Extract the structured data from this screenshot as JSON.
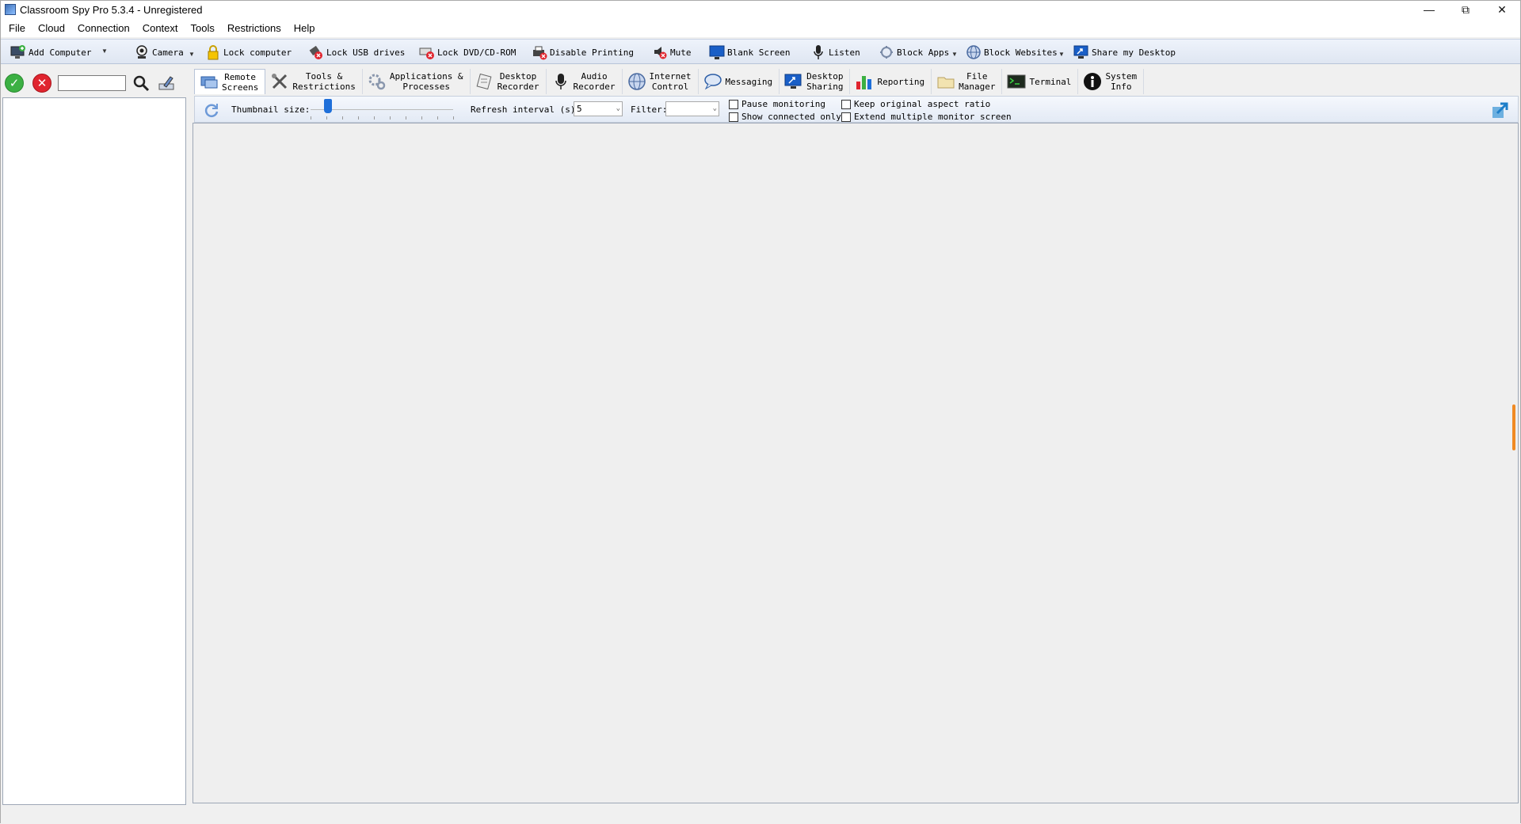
{
  "window": {
    "title": "Classroom Spy Pro 5.3.4 - Unregistered"
  },
  "menu": [
    "File",
    "Cloud",
    "Connection",
    "Context",
    "Tools",
    "Restrictions",
    "Help"
  ],
  "toolbar": {
    "add_computer": "Add Computer",
    "camera": "Camera",
    "lock_computer": "Lock computer",
    "lock_usb": "Lock USB drives",
    "lock_dvd": "Lock DVD/CD-ROM",
    "disable_printing": "Disable Printing",
    "mute": "Mute",
    "blank_screen": "Blank Screen",
    "listen": "Listen",
    "block_apps": "Block Apps",
    "block_websites": "Block Websites",
    "share_desktop": "Share my Desktop"
  },
  "tabs": [
    {
      "line1": "Remote",
      "line2": "Screens"
    },
    {
      "line1": "Tools &",
      "line2": "Restrictions"
    },
    {
      "line1": "Applications &",
      "line2": "Processes"
    },
    {
      "line1": "Desktop",
      "line2": "Recorder"
    },
    {
      "line1": "Audio",
      "line2": "Recorder"
    },
    {
      "line1": "Internet",
      "line2": "Control"
    },
    {
      "line1": "Messaging",
      "line2": ""
    },
    {
      "line1": "Desktop",
      "line2": "Sharing"
    },
    {
      "line1": "Reporting",
      "line2": ""
    },
    {
      "line1": "File",
      "line2": "Manager"
    },
    {
      "line1": "Terminal",
      "line2": ""
    },
    {
      "line1": "System",
      "line2": "Info"
    }
  ],
  "options": {
    "thumbnail_label": "Thumbnail size:",
    "thumbnail_level": 0.1,
    "refresh_label": "Refresh interval (s):",
    "refresh_value": "5",
    "filter_label": "Filter:",
    "filter_value": "",
    "pause_monitoring": "Pause monitoring",
    "show_connected": "Show connected only",
    "keep_aspect": "Keep original aspect ratio",
    "extend_monitor": "Extend multiple monitor screen"
  },
  "left": {
    "search_value": ""
  },
  "colors": {
    "accent": "#1e6fd9",
    "toolbar_bg": "#dfe6f2",
    "ok": "#3cb043",
    "cancel": "#e0252f"
  }
}
